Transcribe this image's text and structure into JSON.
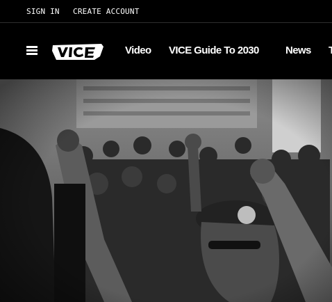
{
  "topbar": {
    "sign_in": "SIGN IN",
    "create_account": "CREATE ACCOUNT"
  },
  "nav": {
    "menu_icon": "hamburger-icon",
    "logo_text": "VICE",
    "items": [
      {
        "label": "Video"
      },
      {
        "label": "VICE Guide To 2030"
      },
      {
        "label": "News"
      },
      {
        "label": "T"
      }
    ]
  },
  "hero": {
    "description_icon": "hero-image"
  },
  "colors": {
    "background": "#000000",
    "text": "#ffffff",
    "divider": "#2e2e2e"
  }
}
